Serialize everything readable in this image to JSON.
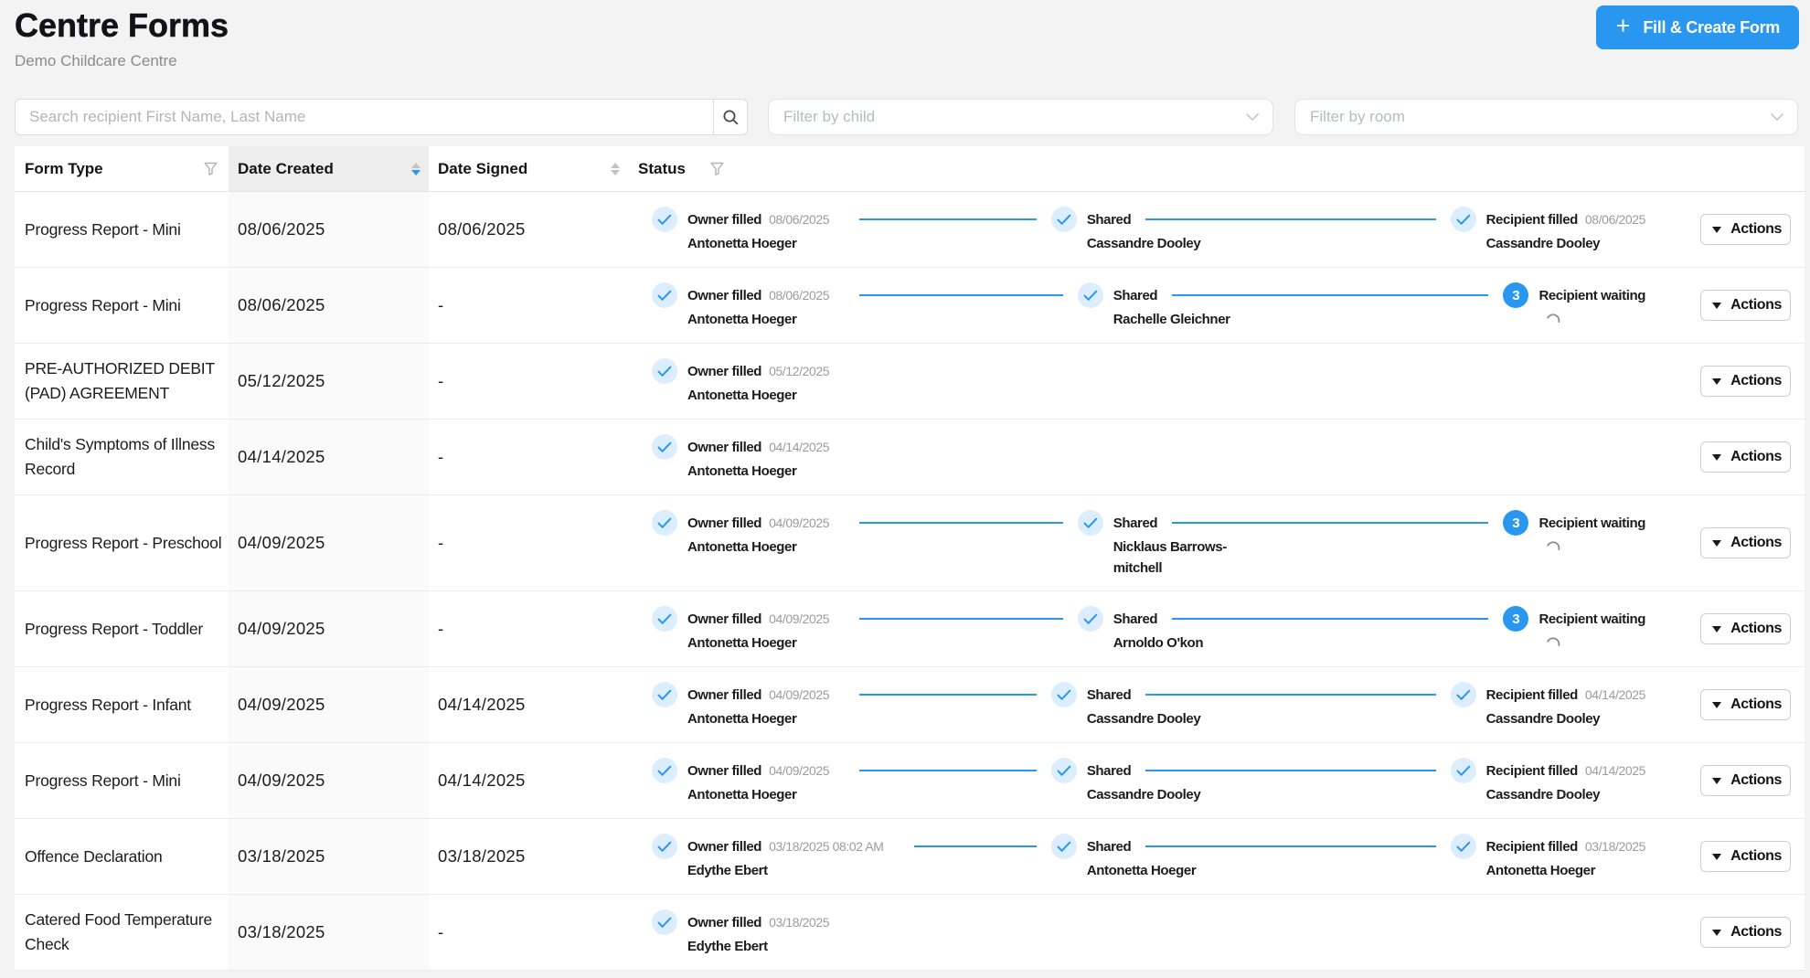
{
  "page": {
    "title": "Centre Forms",
    "subtitle": "Demo Childcare Centre"
  },
  "toolbar": {
    "create_button_label": "Fill & Create Form",
    "create_button_plus": "+"
  },
  "filters": {
    "search_placeholder": "Search recipient First Name, Last Name",
    "child_placeholder": "Filter by child",
    "room_placeholder": "Filter by room"
  },
  "table": {
    "columns": {
      "form_type": "Form Type",
      "date_created": "Date Created",
      "date_signed": "Date Signed",
      "status": "Status"
    },
    "sort": {
      "date_created": "desc",
      "date_signed": "none"
    },
    "actions_label": "Actions",
    "rows": [
      {
        "form_type": "Progress Report - Mini",
        "date_created": "08/06/2025",
        "date_signed": "08/06/2025",
        "steps": [
          {
            "icon": "check",
            "label": "Owner filled",
            "date": "08/06/2025",
            "name": "Antonetta Hoeger"
          },
          {
            "icon": "check",
            "label": "Shared",
            "name": "Cassandre Dooley"
          },
          {
            "icon": "check",
            "label": "Recipient filled",
            "date": "08/06/2025",
            "name": "Cassandre Dooley"
          }
        ]
      },
      {
        "form_type": "Progress Report - Mini",
        "date_created": "08/06/2025",
        "date_signed": "-",
        "steps": [
          {
            "icon": "check",
            "label": "Owner filled",
            "date": "08/06/2025",
            "name": "Antonetta Hoeger"
          },
          {
            "icon": "check",
            "label": "Shared",
            "name": "Rachelle Gleichner"
          },
          {
            "icon": "badge",
            "badge": "3",
            "label": "Recipient waiting",
            "spinner": true
          }
        ]
      },
      {
        "form_type": "PRE-AUTHORIZED DEBIT (PAD) AGREEMENT",
        "date_created": "05/12/2025",
        "date_signed": "-",
        "steps": [
          {
            "icon": "check",
            "label": "Owner filled",
            "date": "05/12/2025",
            "name": "Antonetta Hoeger"
          }
        ]
      },
      {
        "form_type": "Child's Symptoms of Illness Record",
        "date_created": "04/14/2025",
        "date_signed": "-",
        "steps": [
          {
            "icon": "check",
            "label": "Owner filled",
            "date": "04/14/2025",
            "name": "Antonetta Hoeger"
          }
        ]
      },
      {
        "form_type": "Progress Report - Preschool",
        "date_created": "04/09/2025",
        "date_signed": "-",
        "steps": [
          {
            "icon": "check",
            "label": "Owner filled",
            "date": "04/09/2025",
            "name": "Antonetta Hoeger"
          },
          {
            "icon": "check",
            "label": "Shared",
            "name": "Nicklaus Barrows-mitchell"
          },
          {
            "icon": "badge",
            "badge": "3",
            "label": "Recipient waiting",
            "spinner": true
          }
        ]
      },
      {
        "form_type": "Progress Report - Toddler",
        "date_created": "04/09/2025",
        "date_signed": "-",
        "steps": [
          {
            "icon": "check",
            "label": "Owner filled",
            "date": "04/09/2025",
            "name": "Antonetta Hoeger"
          },
          {
            "icon": "check",
            "label": "Shared",
            "name": "Arnoldo O'kon"
          },
          {
            "icon": "badge",
            "badge": "3",
            "label": "Recipient waiting",
            "spinner": true
          }
        ]
      },
      {
        "form_type": "Progress Report - Infant",
        "date_created": "04/09/2025",
        "date_signed": "04/14/2025",
        "steps": [
          {
            "icon": "check",
            "label": "Owner filled",
            "date": "04/09/2025",
            "name": "Antonetta Hoeger"
          },
          {
            "icon": "check",
            "label": "Shared",
            "name": "Cassandre Dooley"
          },
          {
            "icon": "check",
            "label": "Recipient filled",
            "date": "04/14/2025",
            "name": "Cassandre Dooley"
          }
        ]
      },
      {
        "form_type": "Progress Report - Mini",
        "date_created": "04/09/2025",
        "date_signed": "04/14/2025",
        "steps": [
          {
            "icon": "check",
            "label": "Owner filled",
            "date": "04/09/2025",
            "name": "Antonetta Hoeger"
          },
          {
            "icon": "check",
            "label": "Shared",
            "name": "Cassandre Dooley"
          },
          {
            "icon": "check",
            "label": "Recipient filled",
            "date": "04/14/2025",
            "name": "Cassandre Dooley"
          }
        ]
      },
      {
        "form_type": "Offence Declaration",
        "date_created": "03/18/2025",
        "date_signed": "03/18/2025",
        "steps": [
          {
            "icon": "check",
            "label": "Owner filled",
            "date": "03/18/2025 08:02 AM",
            "name": "Edythe Ebert"
          },
          {
            "icon": "check",
            "label": "Shared",
            "name": "Antonetta Hoeger"
          },
          {
            "icon": "check",
            "label": "Recipient filled",
            "date": "03/18/2025",
            "name": "Antonetta Hoeger"
          }
        ]
      },
      {
        "form_type": "Catered Food Temperature Check",
        "date_created": "03/18/2025",
        "date_signed": "-",
        "steps": [
          {
            "icon": "check",
            "label": "Owner filled",
            "date": "03/18/2025",
            "name": "Edythe Ebert"
          }
        ]
      }
    ]
  },
  "colors": {
    "accent": "#2997f0",
    "accent_light": "#dcedfd",
    "page_bg": "#f3f3f3",
    "badge_text": "#ffffff",
    "muted_text": "#9c9c9e"
  },
  "icons": {
    "plus": "plus-icon",
    "search": "search-icon",
    "chevron_down": "chevron-down-icon",
    "filter_funnel": "filter-funnel-icon",
    "sort_caret_up": "sort-asc-icon",
    "sort_caret_down": "sort-desc-icon",
    "check": "check-icon",
    "spinner": "loading-spinner-icon",
    "actions_caret": "caret-down-icon"
  }
}
